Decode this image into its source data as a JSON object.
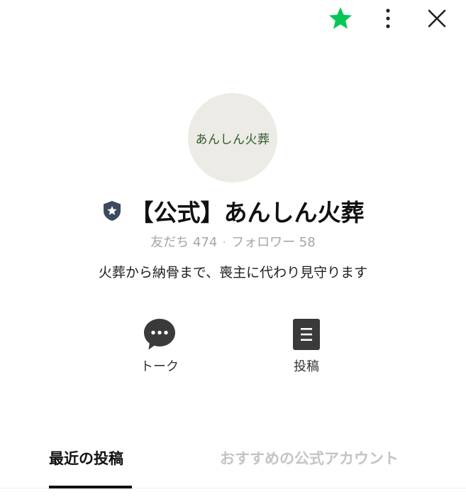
{
  "header": {
    "favorite_icon": "star-icon",
    "favorite_color": "#06c755",
    "more_icon": "more-vertical-icon",
    "close_icon": "close-icon"
  },
  "profile": {
    "avatar_text": "あんしん火葬",
    "official_badge_icon": "official-shield-icon",
    "name": "【公式】あんしん火葬",
    "friends_label": "友だち 474",
    "followers_label": "フォロワー 58",
    "separator": "·",
    "description": "火葬から納骨まで、喪主に代わり見守ります"
  },
  "actions": [
    {
      "label": "トーク",
      "icon": "talk-bubble-icon"
    },
    {
      "label": "投稿",
      "icon": "post-document-icon"
    }
  ],
  "tabs": [
    {
      "label": "最近の投稿",
      "active": true
    },
    {
      "label": "おすすめの公式アカウント",
      "active": false
    }
  ]
}
